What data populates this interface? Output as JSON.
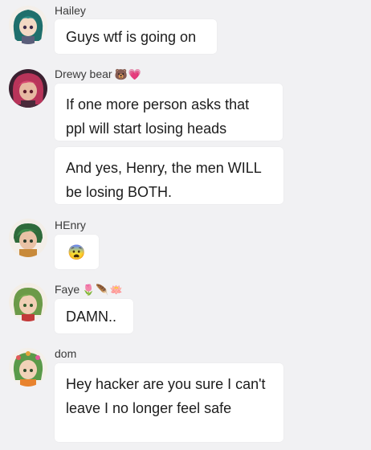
{
  "messages": [
    {
      "username": "Hailey",
      "emojis": "",
      "bubbles": [
        "Guys wtf is going on"
      ]
    },
    {
      "username": "Drewy bear",
      "emojis": "🐻💗",
      "bubbles": [
        "If one more person asks that ppl will start losing heads",
        "And yes, Henry, the men WILL be losing BOTH."
      ]
    },
    {
      "username": "HEnry",
      "emojis": "",
      "bubbles": [
        "😨"
      ]
    },
    {
      "username": "Faye",
      "emojis": "🌷🪶🪷",
      "bubbles": [
        "DAMN.."
      ]
    },
    {
      "username": "dom",
      "emojis": "",
      "bubbles": [
        "Hey hacker are you sure I can't leave I no longer feel safe"
      ]
    }
  ],
  "colors": {
    "background": "#f1f1f3",
    "bubble": "#ffffff",
    "text": "#1c1c1c"
  }
}
